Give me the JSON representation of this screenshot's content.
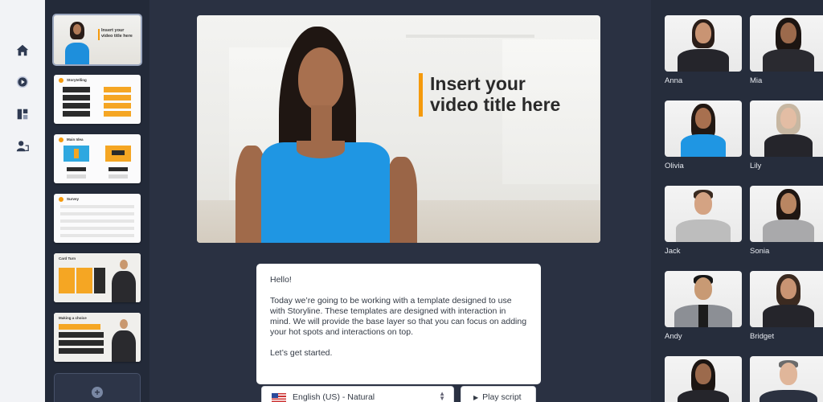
{
  "nav": {
    "items": [
      {
        "icon": "home-icon"
      },
      {
        "icon": "play-circle-icon"
      },
      {
        "icon": "templates-icon"
      },
      {
        "icon": "avatar-people-icon"
      }
    ]
  },
  "preview": {
    "title_line1": "Insert your",
    "title_line2": "video title here"
  },
  "slides": [
    {
      "title": "Insert your video title here"
    },
    {
      "title": "Storytelling"
    },
    {
      "title": "Main Idea"
    },
    {
      "title": "Survey"
    },
    {
      "title": "Card Turn"
    },
    {
      "title": "Making a choice"
    }
  ],
  "script": {
    "greeting": "Hello!",
    "body": "Today we’re going to be working with a template designed to use with Storyline. These templates are designed with interaction in mind. We will provide the base layer so that you can focus on adding your hot spots and interactions on top.",
    "closing": "Let’s get started."
  },
  "controls": {
    "language": "English (US) - Natural",
    "play_label": "Play script"
  },
  "avatars": [
    {
      "name": "Anna"
    },
    {
      "name": "Mia"
    },
    {
      "name": "Olivia"
    },
    {
      "name": "Lily"
    },
    {
      "name": "Jack"
    },
    {
      "name": "Sonia"
    },
    {
      "name": "Andy"
    },
    {
      "name": "Bridget"
    },
    {
      "name": ""
    },
    {
      "name": ""
    }
  ],
  "colors": {
    "accent": "#f59a0c",
    "background": "#2a3142",
    "nav_bg": "#f2f3f6"
  }
}
